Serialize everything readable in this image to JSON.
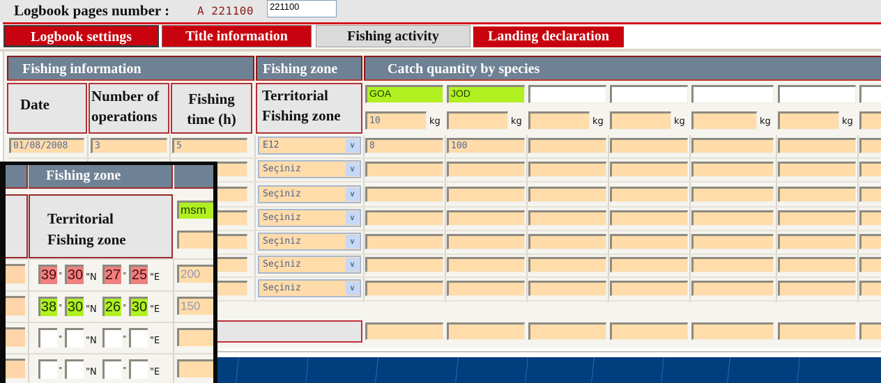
{
  "header": {
    "label": "Logbook pages number :",
    "code": "A 221100",
    "page_number_value": "221100"
  },
  "tabs": [
    {
      "label": "Logbook settings",
      "style": "red"
    },
    {
      "label": "Title information",
      "style": "red"
    },
    {
      "label": "Fishing activity",
      "style": "gray"
    },
    {
      "label": "Landing declaration",
      "style": "red"
    }
  ],
  "table": {
    "group_headers": {
      "fishing_information": "Fishing information",
      "fishing_zone": "Fishing zone",
      "catch_quantity": "Catch quantity by species"
    },
    "column_headers": {
      "date": "Date",
      "operations": "Number of operations",
      "operations_line1": "Number of",
      "operations_line2": "operations",
      "fishing_time_line1": "Fishing",
      "fishing_time_line2": "time (h)",
      "zone_line1": "Territorial",
      "zone_line2": "Fishing zone"
    },
    "species": [
      "GOA",
      "JOD",
      "",
      "",
      "",
      "",
      ""
    ],
    "species_totals_kg": [
      "10",
      "",
      "",
      "",
      "",
      "",
      ""
    ],
    "unit": "kg",
    "rows": [
      {
        "date": "01/08/2008",
        "operations": "3",
        "time": "5",
        "zone": "E12",
        "catches": [
          "8",
          "100",
          "",
          "",
          "",
          "",
          ""
        ]
      },
      {
        "date": "",
        "operations": "",
        "time": "",
        "zone": "Seçiniz",
        "catches": [
          "",
          "",
          "",
          "",
          "",
          "",
          ""
        ]
      },
      {
        "date": "",
        "operations": "",
        "time": "",
        "zone": "Seçiniz",
        "catches": [
          "",
          "",
          "",
          "",
          "",
          "",
          ""
        ]
      },
      {
        "date": "",
        "operations": "",
        "time": "",
        "zone": "Seçiniz",
        "catches": [
          "",
          "",
          "",
          "",
          "",
          "",
          ""
        ]
      },
      {
        "date": "",
        "operations": "",
        "time": "",
        "zone": "Seçiniz",
        "catches": [
          "",
          "",
          "",
          "",
          "",
          "",
          ""
        ]
      },
      {
        "date": "",
        "operations": "",
        "time": "",
        "zone": "Seçiniz",
        "catches": [
          "",
          "",
          "",
          "",
          "",
          "",
          ""
        ]
      },
      {
        "date": "",
        "operations": "",
        "time": "",
        "zone": "Seçiniz",
        "catches": [
          "",
          "",
          "",
          "",
          "",
          "",
          ""
        ]
      }
    ],
    "totals": [
      "",
      "",
      "",
      "",
      "",
      "",
      ""
    ]
  },
  "inset": {
    "header": "Fishing zone",
    "sub_line1": "Territorial",
    "sub_line2": "Fishing zone",
    "species_code": "msm",
    "species_qty": "",
    "degree_symbol": "°",
    "sec_n": "\"N",
    "sec_e": "\"E",
    "rows": [
      {
        "lat_deg": "39",
        "lat_min": "30",
        "lon_deg": "27",
        "lon_min": "25",
        "status": "invalid",
        "qty": "200"
      },
      {
        "lat_deg": "38",
        "lat_min": "30",
        "lon_deg": "26",
        "lon_min": "30",
        "status": "valid",
        "qty": "150"
      },
      {
        "lat_deg": "",
        "lat_min": "",
        "lon_deg": "",
        "lon_min": "",
        "status": "empty",
        "qty": ""
      },
      {
        "lat_deg": "",
        "lat_min": "",
        "lon_deg": "",
        "lon_min": "",
        "status": "empty",
        "qty": ""
      }
    ]
  },
  "colors": {
    "tab_red": "#c8030f",
    "header_slate": "#6f8194",
    "field_peach": "#ffdcaa",
    "species_green": "#b0f020",
    "invalid_red": "#f08080",
    "footer_blue": "#003e7e"
  }
}
